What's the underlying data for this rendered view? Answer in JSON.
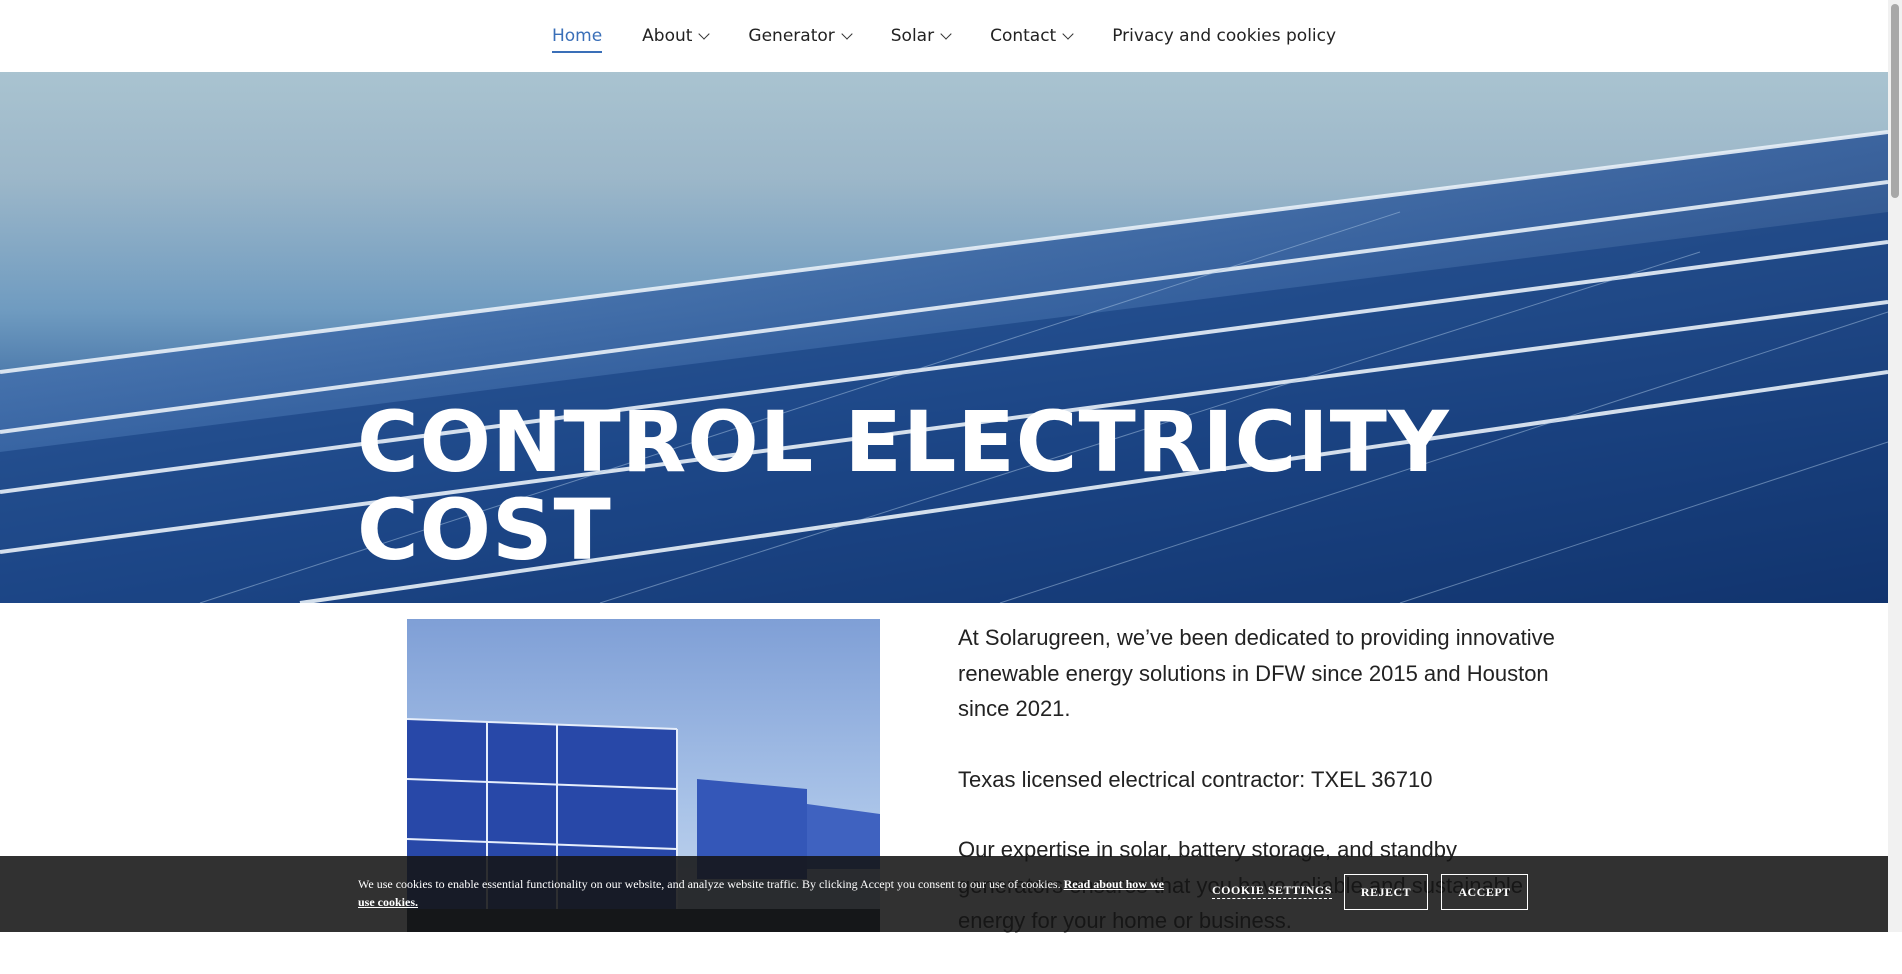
{
  "nav": {
    "items": [
      {
        "label": "Home",
        "active": true,
        "dropdown": false
      },
      {
        "label": "About",
        "active": false,
        "dropdown": true
      },
      {
        "label": "Generator",
        "active": false,
        "dropdown": true
      },
      {
        "label": "Solar",
        "active": false,
        "dropdown": true
      },
      {
        "label": "Contact",
        "active": false,
        "dropdown": true
      },
      {
        "label": "Privacy and cookies policy",
        "active": false,
        "dropdown": false
      }
    ],
    "accent_color": "#3a6fb8"
  },
  "hero": {
    "title": "CONTROL ELECTRICITY COST",
    "image_subject": "solar panels under sky"
  },
  "content": {
    "image_subject": "ground-mounted solar panels",
    "paragraphs": [
      "At Solarugreen, we’ve been dedicated to providing innovative renewable energy solutions in DFW since 2015 and Houston since 2021.",
      "Texas licensed electrical contractor:  TXEL 36710",
      " Our expertise in solar, battery storage, and standby generators ensures that you have reliable and sustainable energy for your home or business."
    ]
  },
  "cookie_banner": {
    "text": "We use cookies to enable essential functionality on our website, and analyze website traffic. By clicking Accept you consent to our use of cookies.",
    "link_text": "Read about how we use cookies.",
    "settings_label": "COOKIE SETTINGS",
    "reject_label": "REJECT",
    "accept_label": "ACCEPT"
  }
}
